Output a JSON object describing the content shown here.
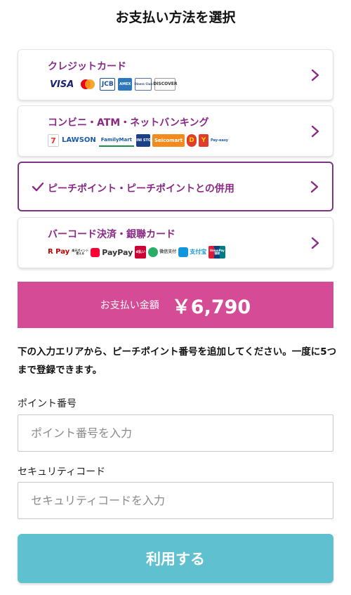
{
  "header": {
    "title": "お支払い方法を選択"
  },
  "payment_methods": [
    {
      "title": "クレジットカード",
      "selected": false,
      "logos": [
        {
          "name": "visa",
          "text": "VISA"
        },
        {
          "name": "mastercard",
          "text": ""
        },
        {
          "name": "jcb",
          "text": "JCB"
        },
        {
          "name": "amex",
          "text": "AMEX"
        },
        {
          "name": "diners",
          "text": "Diners Club"
        },
        {
          "name": "discover",
          "text": "DISCOVER"
        }
      ]
    },
    {
      "title": "コンビニ・ATM・ネットバンキング",
      "selected": false,
      "logos": [
        {
          "name": "seven-eleven",
          "text": "7"
        },
        {
          "name": "lawson",
          "text": "LAWSON"
        },
        {
          "name": "familymart",
          "text": "FamilyMart"
        },
        {
          "name": "ministop",
          "text": "MINI STOP"
        },
        {
          "name": "seicomart",
          "text": "Seicomart"
        },
        {
          "name": "daily-yamazaki",
          "text": "D"
        },
        {
          "name": "yamazaki",
          "text": "Y"
        },
        {
          "name": "payeasy",
          "text": "Pay-easy"
        }
      ]
    },
    {
      "title": "ピーチポイント・ピーチポイントとの併用",
      "selected": true,
      "logos": []
    },
    {
      "title": "バーコード決済・銀聯カード",
      "selected": false,
      "logos": [
        {
          "name": "rakuten-pay",
          "text": "R Pay"
        },
        {
          "name": "rakuten-point",
          "text": "楽天ポイント 使える"
        },
        {
          "name": "paypay",
          "text": "PayPay"
        },
        {
          "name": "d-barai",
          "text": "d払い"
        },
        {
          "name": "wechat-pay",
          "text": "微信支付"
        },
        {
          "name": "alipay",
          "text": "支付宝"
        },
        {
          "name": "unionpay",
          "text": "UnionPay 银联"
        }
      ]
    }
  ],
  "amount": {
    "label": "お支払い金額",
    "value": "￥6,790"
  },
  "instructions": "下の入力エリアから、ピーチポイント番号を追加してください。一度に5つまで登録できます。",
  "form": {
    "point_number": {
      "label": "ポイント番号",
      "placeholder": "ポイント番号を入力",
      "value": ""
    },
    "security_code": {
      "label": "セキュリティコード",
      "placeholder": "セキュリティコードを入力",
      "value": ""
    }
  },
  "submit": {
    "label": "利用する"
  },
  "colors": {
    "accent_purple": "#8a2a86",
    "selected_border": "#7d3483",
    "amount_bar": "#d54b95",
    "submit_button": "#5fc1cf"
  }
}
